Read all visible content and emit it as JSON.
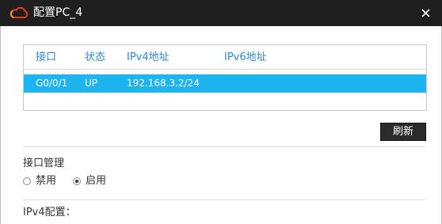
{
  "window": {
    "title": "配置PC_4",
    "icon": "cloud-icon",
    "close_icon": "close-icon"
  },
  "interface_table": {
    "headers": [
      "接口",
      "状态",
      "IPv4地址",
      "IPv6地址"
    ],
    "rows": [
      {
        "interface": "G0/0/1",
        "status": "UP",
        "ipv4": "192.168.3.2/24",
        "ipv6": ""
      }
    ]
  },
  "refresh_button": {
    "label": "刷新"
  },
  "interface_management": {
    "title": "接口管理",
    "options": [
      {
        "label": "禁用",
        "selected": false
      },
      {
        "label": "启用",
        "selected": true
      }
    ]
  },
  "ipv4_config": {
    "title": "IPv4配置："
  },
  "colors": {
    "title_bar": "#1f1f1f",
    "header_text": "#2a8ad8",
    "selected_row": "#1eb4f0",
    "button_bg": "#2b2b2b"
  }
}
